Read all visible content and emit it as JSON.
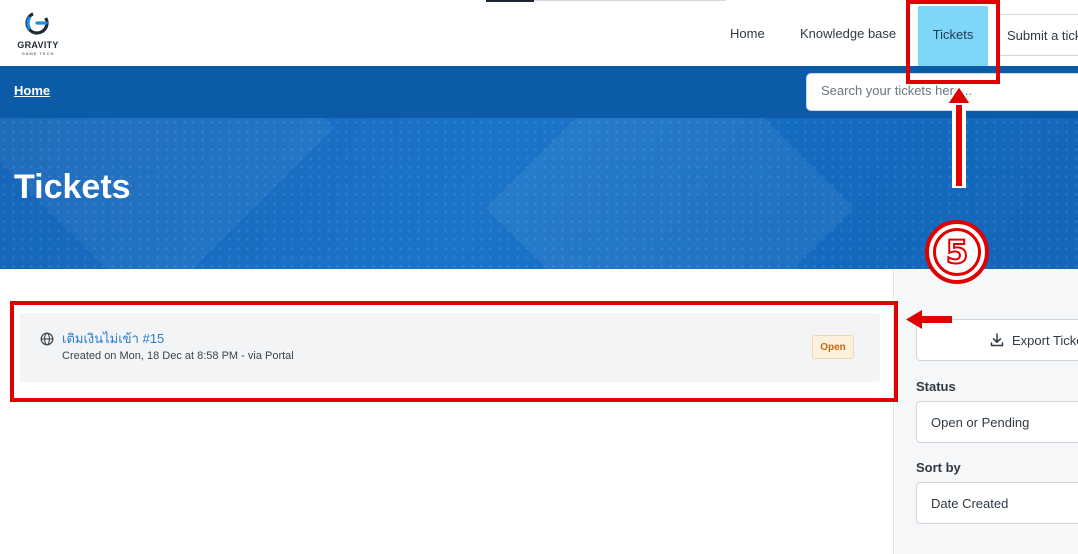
{
  "header": {
    "logo_text": "GRAVITY",
    "logo_subtext": "GAME TECH",
    "nav": {
      "home": "Home",
      "knowledge_base": "Knowledge base",
      "tickets": "Tickets",
      "submit": "Submit a ticket"
    }
  },
  "breadcrumb": {
    "home": "Home"
  },
  "search": {
    "placeholder": "Search your tickets here..."
  },
  "hero": {
    "title": "Tickets"
  },
  "tickets": [
    {
      "title": "เติมเงินไม่เข้า #15",
      "meta": "Created on Mon, 18 Dec at 8:58 PM - via Portal",
      "status": "Open",
      "icon": "globe-icon"
    }
  ],
  "sidebar": {
    "export_label": "Export Tickets",
    "status_label": "Status",
    "status_value": "Open or Pending",
    "sort_label": "Sort by",
    "sort_value": "Date Created"
  },
  "annotation": {
    "step": "5",
    "color": "#e00000"
  }
}
